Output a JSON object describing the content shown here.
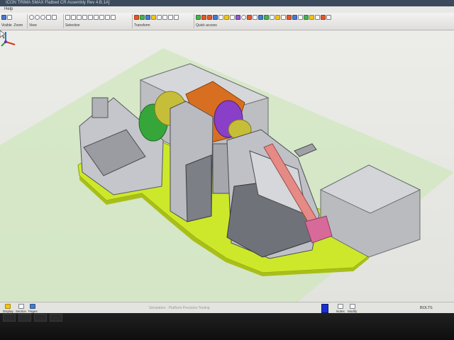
{
  "window": {
    "title": "ICON TRIMA SMAX Flatbed CR Assembly Rev 4.B.1A]"
  },
  "menu": {
    "help": "Help"
  },
  "ribbon": {
    "groups": [
      {
        "label_left": "Visible",
        "label_right": "Zoom"
      },
      {
        "label": "View"
      },
      {
        "label": "Selection"
      },
      {
        "label": "Transform"
      },
      {
        "label": "Quick access"
      }
    ]
  },
  "status": {
    "middle_text": "Simulation · Platform Precision Tooling",
    "right_text": "BOLTS",
    "bottom_tools": [
      "Display",
      "Section",
      "Pages"
    ],
    "right_tools": [
      "Notes",
      "Modify"
    ]
  },
  "colors": {
    "ground_plane": "#c9e6b3",
    "base_plate": "#cde82a",
    "housing": "#c3c5cc",
    "orange_part": "#d86f20",
    "purple_part": "#8a3fc8",
    "green_ring": "#37a63a",
    "pink_part": "#e68a86"
  },
  "icons": {
    "cursor": "arrow-cursor-icon",
    "axis_triad": "axis-triad-icon"
  }
}
